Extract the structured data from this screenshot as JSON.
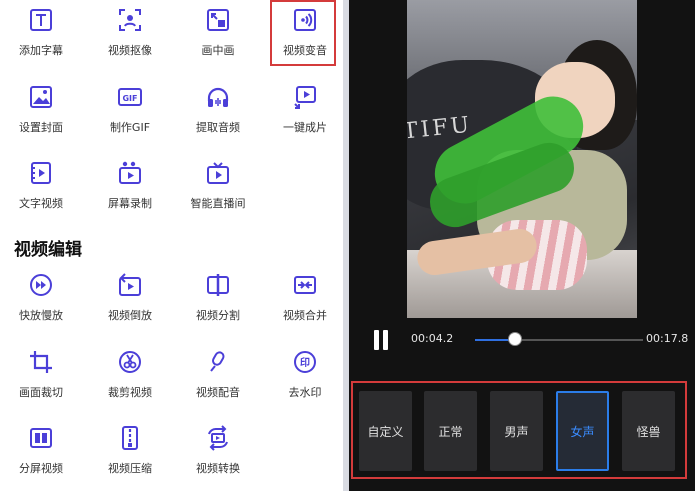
{
  "tools": [
    {
      "label": "添加字幕",
      "icon": "text-caption-icon"
    },
    {
      "label": "视频抠像",
      "icon": "portrait-cutout-icon"
    },
    {
      "label": "画中画",
      "icon": "picture-in-picture-icon"
    },
    {
      "label": "视频变音",
      "icon": "voice-change-icon"
    },
    {
      "label": "设置封面",
      "icon": "cover-image-icon"
    },
    {
      "label": "制作GIF",
      "icon": "gif-icon"
    },
    {
      "label": "提取音频",
      "icon": "headphones-icon"
    },
    {
      "label": "一键成片",
      "icon": "one-click-video-icon"
    },
    {
      "label": "文字视频",
      "icon": "text-video-icon"
    },
    {
      "label": "屏幕录制",
      "icon": "screen-record-icon"
    },
    {
      "label": "智能直播间",
      "icon": "tv-live-icon"
    }
  ],
  "section_title": "视频编辑",
  "edit_tools": [
    {
      "label": "快放慢放",
      "icon": "speed-icon"
    },
    {
      "label": "视频倒放",
      "icon": "reverse-icon"
    },
    {
      "label": "视频分割",
      "icon": "split-icon"
    },
    {
      "label": "视频合并",
      "icon": "merge-icon"
    },
    {
      "label": "画面裁切",
      "icon": "crop-icon"
    },
    {
      "label": "裁剪视频",
      "icon": "scissors-icon"
    },
    {
      "label": "视频配音",
      "icon": "microphone-icon"
    },
    {
      "label": "去水印",
      "icon": "watermark-icon"
    },
    {
      "label": "分屏视频",
      "icon": "split-screen-icon"
    },
    {
      "label": "视频压缩",
      "icon": "compress-icon"
    },
    {
      "label": "视频转换",
      "icon": "convert-icon"
    }
  ],
  "player": {
    "preview_text": "TIFU",
    "current_time": "00:04.2",
    "total_time": "00:17.8",
    "progress": 0.236
  },
  "voice_options": [
    "自定义",
    "正常",
    "男声",
    "女声",
    "怪兽"
  ],
  "selected_voice": "女声",
  "colors": {
    "accent": "#4b3fd8",
    "highlight": "#d43b3b",
    "selected": "#2b7de9"
  }
}
